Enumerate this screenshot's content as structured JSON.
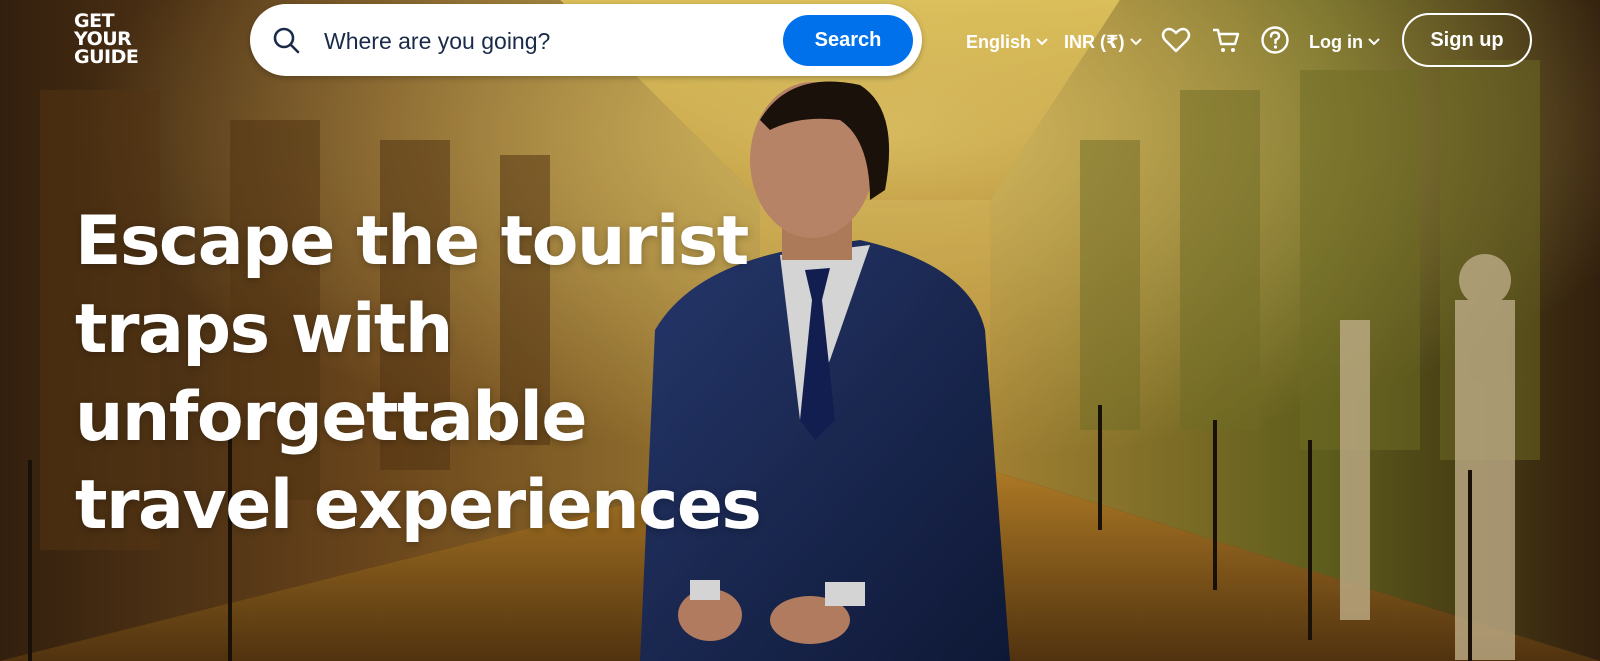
{
  "logo": {
    "line1": "GET",
    "line2": "YOUR",
    "line3": "GUIDE"
  },
  "search": {
    "placeholder": "Where are you going?",
    "button_label": "Search"
  },
  "nav": {
    "language": "English",
    "currency": "INR (₹)",
    "login": "Log in",
    "signup": "Sign up"
  },
  "hero": {
    "headline": [
      "Escape the tourist",
      "traps with",
      "unforgettable",
      "travel experiences"
    ]
  },
  "colors": {
    "brand_blue": "#0071eb",
    "text_dark": "#1a2b49"
  }
}
